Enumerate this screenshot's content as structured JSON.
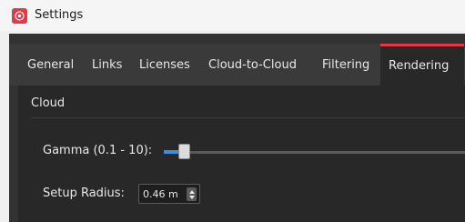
{
  "window": {
    "title": "Settings",
    "app_icon": "app-logo-icon"
  },
  "tabs": [
    {
      "label": "General",
      "active": false
    },
    {
      "label": "Links",
      "active": false
    },
    {
      "label": "Licenses",
      "active": false
    },
    {
      "label": "Cloud-to-Cloud",
      "active": false
    },
    {
      "label": "Filtering",
      "active": false
    },
    {
      "label": "Rendering",
      "active": true
    }
  ],
  "rendering": {
    "group_title": "Cloud",
    "gamma": {
      "label": "Gamma (0.1 - 10):",
      "min": 0.1,
      "max": 10,
      "position_fraction": 0.05
    },
    "setup_radius": {
      "label": "Setup Radius:",
      "value": "0.46 m"
    }
  },
  "colors": {
    "accent": "#e23a44",
    "slider_fill": "#3b8ee0",
    "panel": "#282828",
    "tabbar": "#3a3a3a"
  }
}
